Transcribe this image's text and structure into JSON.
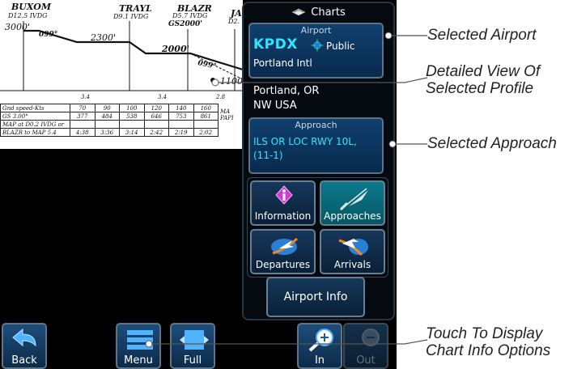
{
  "profile": {
    "fixes": [
      {
        "name": "BUXOM",
        "dist": "D12.5 IVDG"
      },
      {
        "name": "TRAYL",
        "dist": "D9.1 IVDG"
      },
      {
        "name": "BLAZR",
        "dist": "D5.7 IVDG"
      },
      {
        "name": "JA",
        "dist": "D2."
      }
    ],
    "altitudes": {
      "buxom": "3000'",
      "trayl": "2300'",
      "blazr": "2000'",
      "blazr_gs": "GS2000'",
      "low": "1100'"
    },
    "headings": {
      "h1": "099°",
      "h2": "099°"
    },
    "segment_distances": [
      "3.4",
      "3.4",
      "2.8"
    ]
  },
  "speed_table": {
    "header": [
      "Gnd speed-Kts",
      "70",
      "90",
      "100",
      "120",
      "140",
      "160"
    ],
    "rows": [
      [
        "GS 3.00°",
        "377",
        "484",
        "538",
        "646",
        "753",
        "861"
      ],
      [
        "MAP at D0.2 IVDG or",
        "",
        "",
        "",
        "",
        "",
        ""
      ],
      [
        "BLAZR to MAP 5.4",
        "4:38",
        "3:36",
        "3:14",
        "2:42",
        "2:19",
        "2:02"
      ]
    ],
    "side_labels": [
      "MA",
      "PAPI"
    ]
  },
  "pane": {
    "title": "Charts",
    "airport": {
      "header": "Airport",
      "code": "KPDX",
      "type": "Public",
      "name": "Portland Intl",
      "city": "Portland, OR",
      "region": "NW USA"
    },
    "approach": {
      "header": "Approach",
      "line1": "ILS OR LOC RWY 10L,",
      "line2": "(11-1)"
    },
    "tiles": [
      {
        "label": "Information",
        "icon": "information-icon"
      },
      {
        "label": "Approaches",
        "icon": "approach-plane-icon"
      },
      {
        "label": "Departures",
        "icon": "departure-plane-icon"
      },
      {
        "label": "Arrivals",
        "icon": "arrival-plane-icon"
      }
    ],
    "airport_info_label": "Airport Info"
  },
  "bottom_bar": {
    "back": "Back",
    "menu": "Menu",
    "full": "Full",
    "zoom_in": "In",
    "zoom_out": "Out"
  },
  "callouts": {
    "selected_airport": "Selected Airport",
    "detailed_view_l1": "Detailed View Of",
    "detailed_view_l2": "Selected Profile",
    "selected_approach": "Selected Approach",
    "touch_display_l1": "Touch To Display",
    "touch_display_l2": "Chart Info Options"
  },
  "colors": {
    "accent_cyan": "#2fe6ff",
    "button_blue": "#10406e",
    "selected_teal": "#0b7a8c"
  }
}
